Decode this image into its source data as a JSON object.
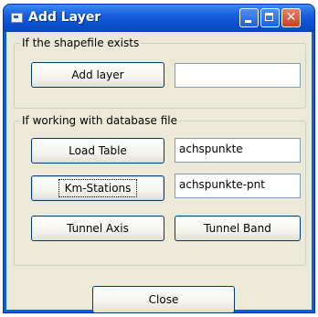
{
  "window": {
    "title": "Add Layer",
    "close_glyph": "✕"
  },
  "group_existing": {
    "label": "If the shapefile exists",
    "add_layer_label": "Add layer",
    "add_layer_value": ""
  },
  "group_database": {
    "label": "If working with database file",
    "load_table_label": "Load Table",
    "load_table_value": "achspunkte",
    "km_stations_label": "Km-Stations",
    "km_stations_value": "achspunkte-pnt",
    "tunnel_axis_label": "Tunnel Axis",
    "tunnel_band_label": "Tunnel Band"
  },
  "footer": {
    "close_label": "Close"
  }
}
